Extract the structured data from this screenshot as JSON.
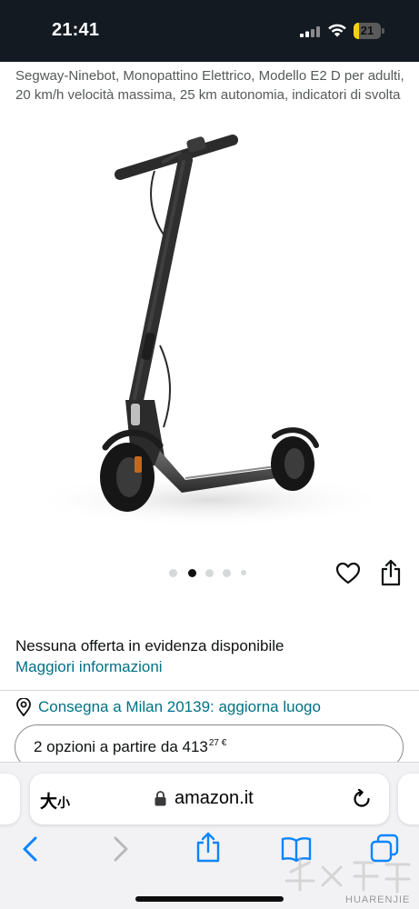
{
  "status_bar": {
    "time": "21:41",
    "battery_level": "21",
    "battery_fraction": 0.21,
    "icons": [
      "signal-icon",
      "wifi-icon",
      "battery-icon"
    ]
  },
  "product": {
    "title": "Segway-Ninebot, Monopattino Elettrico, Modello E2 D per adulti, 20 km/h velocità massima, 25 km autonomia, indicatori di svolta",
    "image_count": 5,
    "active_image_index": 1
  },
  "offer": {
    "no_featured": "Nessuna offerta in evidenza disponibile",
    "more_info": "Maggiori informazioni",
    "delivery": "Consegna a Milan 20139: aggiorna luogo",
    "options_prefix": "2 opzioni a partire da 413",
    "options_sup": "27 €"
  },
  "browser": {
    "text_size_label_big": "大",
    "text_size_label_small": "小",
    "url": "amazon.it",
    "toolbar_icons": [
      "back-icon",
      "forward-icon",
      "share-icon",
      "bookmarks-icon",
      "tabs-icon"
    ]
  },
  "watermark": {
    "text": "HUARENJIE"
  },
  "colors": {
    "status_bg": "#131a22",
    "link": "#007185",
    "safari_blue": "#0a84ff",
    "battery_yellow": "#f5d016"
  }
}
